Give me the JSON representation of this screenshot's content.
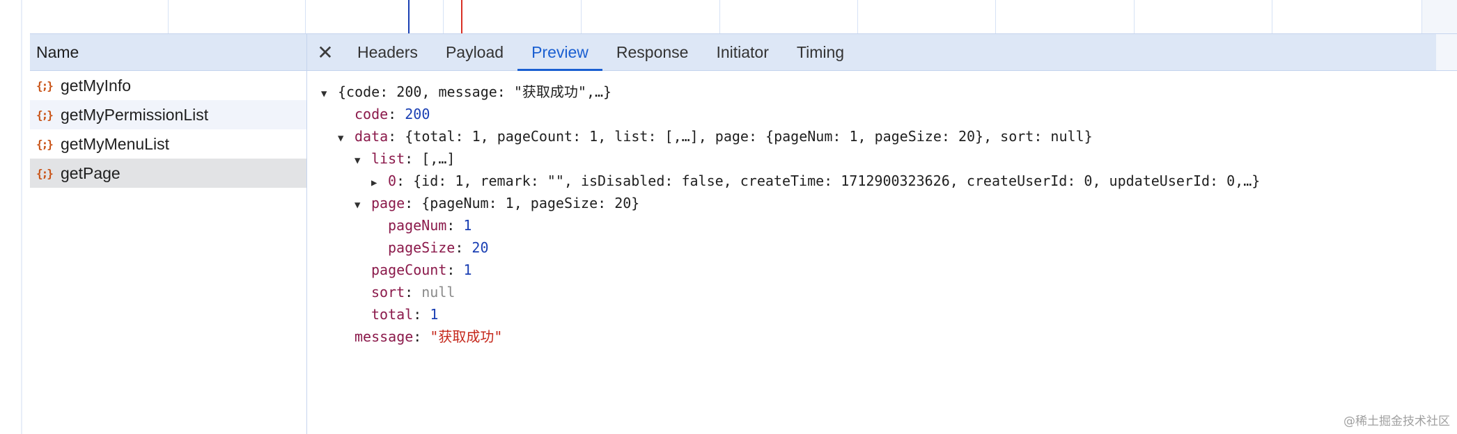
{
  "name_column": {
    "header": "Name",
    "icon_glyph": "{;}",
    "requests": [
      {
        "label": "getMyInfo"
      },
      {
        "label": "getMyPermissionList"
      },
      {
        "label": "getMyMenuList"
      },
      {
        "label": "getPage"
      }
    ]
  },
  "tabs": {
    "close_glyph": "✕",
    "items": [
      "Headers",
      "Payload",
      "Preview",
      "Response",
      "Initiator",
      "Timing"
    ],
    "active": "Preview"
  },
  "preview": {
    "root_summary": "{code: 200, message: \"获取成功\",…}",
    "code_key": "code",
    "code_value": "200",
    "data_key": "data",
    "data_summary": "{total: 1, pageCount: 1, list: [,…], page: {pageNum: 1, pageSize: 20}, sort: null}",
    "list_key": "list",
    "list_summary": "[,…]",
    "item0_key": "0",
    "item0_summary": "{id: 1, remark: \"\", isDisabled: false, createTime: 1712900323626, createUserId: 0, updateUserId: 0,…}",
    "page_key": "page",
    "page_summary": "{pageNum: 1, pageSize: 20}",
    "pageNum_key": "pageNum",
    "pageNum_value": "1",
    "pageSize_key": "pageSize",
    "pageSize_value": "20",
    "pageCount_key": "pageCount",
    "pageCount_value": "1",
    "sort_key": "sort",
    "sort_value": "null",
    "total_key": "total",
    "total_value": "1",
    "message_key": "message",
    "message_value": "\"获取成功\""
  },
  "watermark": "@稀土掘金技术社区",
  "colors": {
    "accent": "#1a5fd1",
    "header_bg": "#dde7f6",
    "key": "#8b1a4b",
    "number": "#1a3fb3",
    "string": "#c5281c"
  }
}
